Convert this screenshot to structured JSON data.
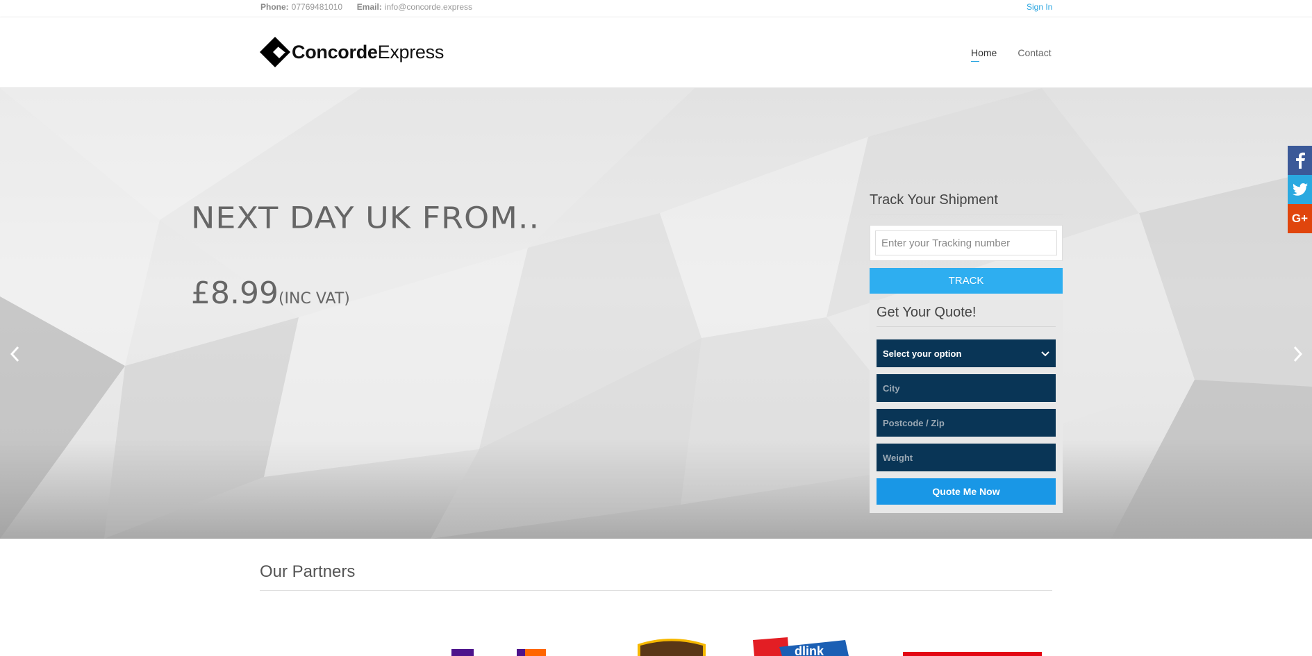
{
  "topbar": {
    "phone_label": "Phone:",
    "phone": "07769481010",
    "email_label": "Email:",
    "email": "info@concorde.express",
    "signin": "Sign In"
  },
  "header": {
    "logo_bold": "Concorde",
    "logo_light": "Express",
    "nav": [
      "Home",
      "Contact"
    ]
  },
  "hero": {
    "headline": "NEXT DAY UK FROM..",
    "price": "£8.99",
    "price_note": "(INC VAT)"
  },
  "track": {
    "title": "Track Your Shipment",
    "placeholder": "Enter your Tracking number",
    "button": "TRACK"
  },
  "quote": {
    "title": "Get Your Quote!",
    "select": "Select your option",
    "city_placeholder": "City",
    "postcode_placeholder": "Postcode / Zip",
    "weight_placeholder": "Weight",
    "button": "Quote Me Now"
  },
  "social": [
    "facebook-icon",
    "twitter-icon",
    "google-plus-icon"
  ],
  "partners": {
    "title": "Our Partners",
    "logos": [
      "fedex-logo",
      "ups-logo",
      "parcelink-logo",
      "royal-mail-logo"
    ]
  },
  "colors": {
    "accent": "#2eaef0",
    "navy": "#093556",
    "quote_button": "#1997e6",
    "facebook": "#3b5998",
    "twitter": "#2aa9e0",
    "google_plus": "#e0450d"
  }
}
